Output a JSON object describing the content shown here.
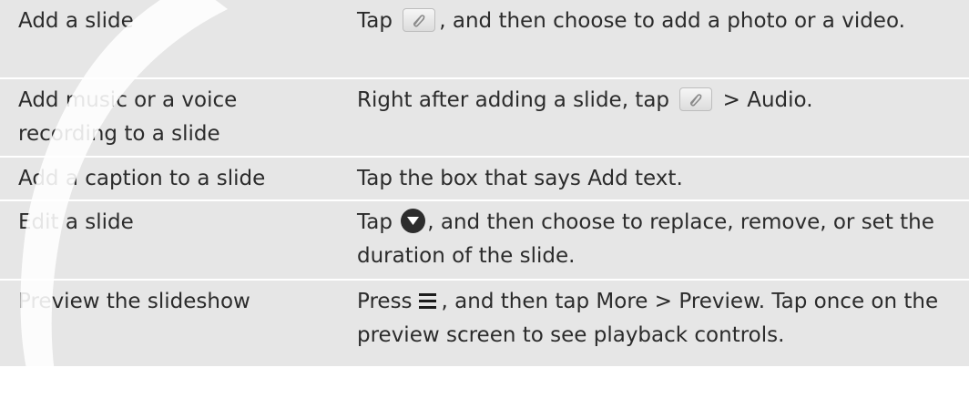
{
  "rows": [
    {
      "action": "Add a slide",
      "t1": "Tap",
      "t2": ", and then choose to add a photo or a video."
    },
    {
      "action": "Add music or a voice recording to a slide",
      "t1": "Right after adding a slide, tap",
      "t2": " > ",
      "t3": "Audio",
      "t4": "."
    },
    {
      "action": "Add a caption to a slide",
      "t1": "Tap the box that says ",
      "t2": "Add text",
      "t3": "."
    },
    {
      "action": "Edit a slide",
      "t1": "Tap ",
      "t2": ", and then choose to replace, remove, or set the duration of the slide."
    },
    {
      "action": "Preview the slideshow",
      "t1": "Press",
      "t2": ", and then tap ",
      "t3": "More",
      "t4": " > ",
      "t5": "Preview",
      "t6": ". Tap once on the preview screen to see playback controls."
    }
  ],
  "icons": {
    "attach": "paperclip-icon",
    "edit": "down-arrow-circle-icon",
    "menu": "menu-icon"
  }
}
